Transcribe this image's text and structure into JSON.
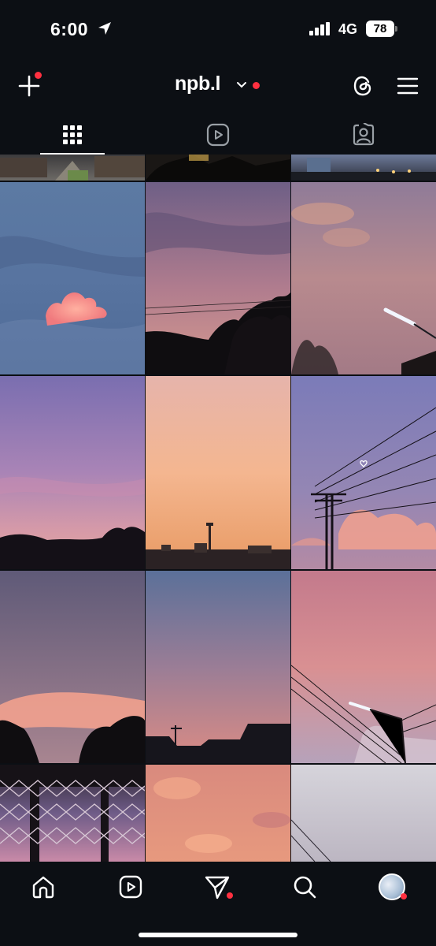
{
  "status_bar": {
    "time": "6:00",
    "network": "4G",
    "battery": "78",
    "icons": [
      "location-arrow-icon",
      "cellular-signal-icon",
      "battery-icon"
    ]
  },
  "header": {
    "username": "npb.l",
    "icons": [
      "create-plus-icon",
      "chevron-down-icon",
      "threads-icon",
      "menu-icon"
    ],
    "notification_color": "#ff3040"
  },
  "tabs": [
    {
      "name": "posts-grid",
      "icon": "grid-icon",
      "selected": true
    },
    {
      "name": "reels",
      "icon": "reels-icon",
      "selected": false
    },
    {
      "name": "tagged",
      "icon": "tagged-person-icon",
      "selected": false
    }
  ],
  "grid": {
    "columns": 3,
    "rows_visible": 5,
    "posts": [
      {
        "desc": "street at dusk"
      },
      {
        "desc": "trees silhouette"
      },
      {
        "desc": "city lights"
      },
      {
        "desc": "blue sky with pink cloud"
      },
      {
        "desc": "purple sky with palm silhouette"
      },
      {
        "desc": "pink sky with streetlight"
      },
      {
        "desc": "purple sunset over hills"
      },
      {
        "desc": "orange gradient sky over town"
      },
      {
        "desc": "power lines with pink clouds"
      },
      {
        "desc": "pink cloud band with trees"
      },
      {
        "desc": "blue to pink sky over rooftops"
      },
      {
        "desc": "pink sky with lit streetlight"
      },
      {
        "desc": "chain link fence at dusk"
      },
      {
        "desc": "orange clouds"
      },
      {
        "desc": "pale sky with wires"
      }
    ]
  },
  "bottom_nav": [
    {
      "name": "home",
      "icon": "home-icon"
    },
    {
      "name": "reels",
      "icon": "reels-icon"
    },
    {
      "name": "messages",
      "icon": "send-icon"
    },
    {
      "name": "search",
      "icon": "search-icon"
    },
    {
      "name": "profile",
      "icon": "avatar"
    }
  ]
}
